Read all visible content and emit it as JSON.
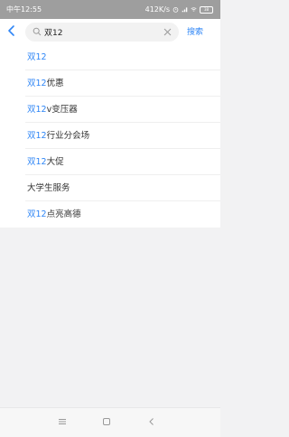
{
  "status_bar": {
    "time": "中午12:55",
    "net_speed": "412K/s",
    "battery": "38"
  },
  "search": {
    "value": "双12",
    "button_label": "搜索"
  },
  "suggestions": [
    {
      "highlight": "双12",
      "rest": ""
    },
    {
      "highlight": "双12",
      "rest": "优惠"
    },
    {
      "highlight": "双12",
      "rest": "v变压器"
    },
    {
      "highlight": "双12",
      "rest": "行业分会场"
    },
    {
      "highlight": "双12",
      "rest": "大促"
    },
    {
      "highlight": "",
      "rest": "大学生服务"
    },
    {
      "highlight": "双12",
      "rest": "点亮高德"
    }
  ],
  "colors": {
    "accent": "#2f86f6",
    "status_bar": "#9e9e9e",
    "page_background": "#f2f2f3"
  }
}
